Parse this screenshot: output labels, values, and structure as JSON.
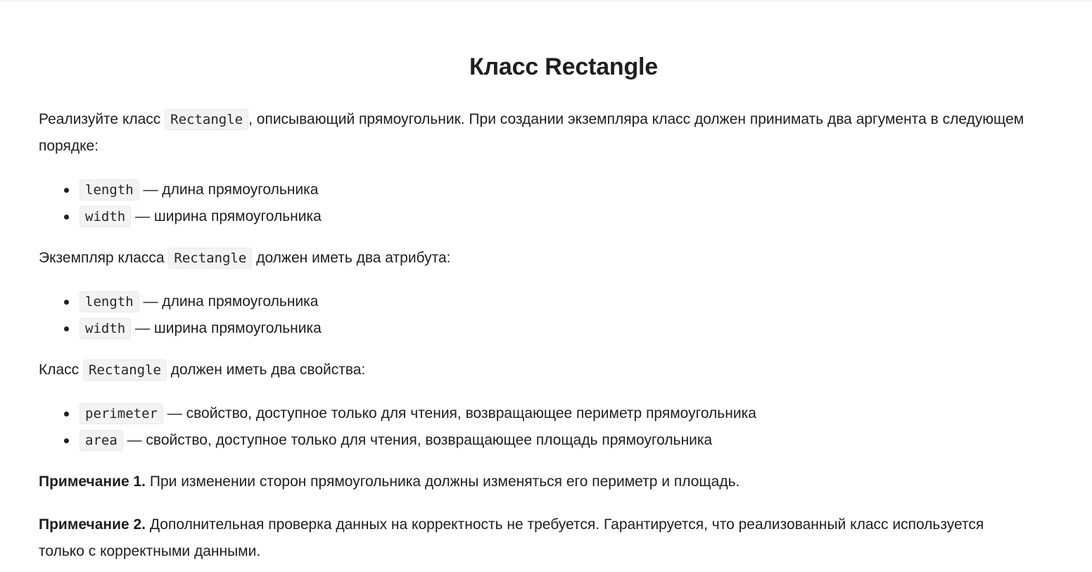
{
  "title": "Класс Rectangle",
  "intro": {
    "before": "Реализуйте класс ",
    "code": "Rectangle",
    "after": ", описывающий прямоугольник. При создании экземпляра класс должен принимать два аргумента в следующем порядке:"
  },
  "args_list": [
    {
      "code": "length",
      "text": " — длина прямоугольника"
    },
    {
      "code": "width",
      "text": " — ширина прямоугольника"
    }
  ],
  "attrs_intro": {
    "before": "Экземпляр класса ",
    "code": "Rectangle",
    "after": " должен иметь два атрибута:"
  },
  "attrs_list": [
    {
      "code": "length",
      "text": " — длина прямоугольника"
    },
    {
      "code": "width",
      "text": " — ширина прямоугольника"
    }
  ],
  "props_intro": {
    "before": "Класс ",
    "code": "Rectangle",
    "after": " должен иметь два свойства:"
  },
  "props_list": [
    {
      "code": "perimeter",
      "text": " — свойство, доступное только для чтения, возвращающее периметр прямоугольника"
    },
    {
      "code": "area",
      "text": " — свойство, доступное только для чтения, возвращающее площадь прямоугольника"
    }
  ],
  "note1": {
    "label": "Примечание 1.",
    "text": " При изменении сторон прямоугольника должны изменяться его периметр и площадь."
  },
  "note2": {
    "label": "Примечание 2.",
    "text": " Дополнительная проверка данных на корректность не требуется. Гарантируется, что реализованный класс используется только с корректными данными."
  }
}
